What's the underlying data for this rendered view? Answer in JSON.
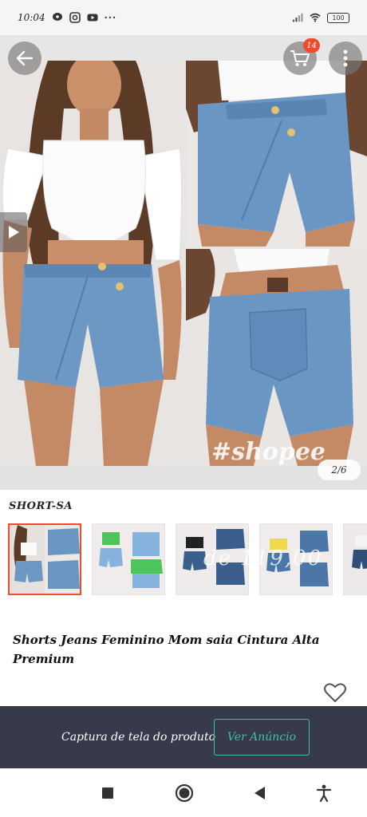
{
  "status_bar": {
    "time": "10:04",
    "battery": "100"
  },
  "header": {
    "cart_count": "14"
  },
  "gallery": {
    "watermark": "#shopee",
    "page_indicator": "2/6"
  },
  "variation": {
    "title": "SHORT-SA",
    "faded_price": "de 119,00"
  },
  "product": {
    "title": "Shorts Jeans Feminino Mom saia Cintura Alta Premium"
  },
  "cta": {
    "label": "Captura de tela do produto",
    "button_label": "Ver Anúncio"
  },
  "colors": {
    "accent": "#ee4d2d",
    "cta_bar": "#363a4a",
    "cta_button": "#3fbf9f",
    "denim": "#6d98c4"
  },
  "icons": [
    "back-arrow-icon",
    "cart-icon",
    "more-vertical-icon",
    "play-icon",
    "heart-icon",
    "recent-apps-icon",
    "home-icon",
    "back-icon",
    "accessibility-icon"
  ]
}
